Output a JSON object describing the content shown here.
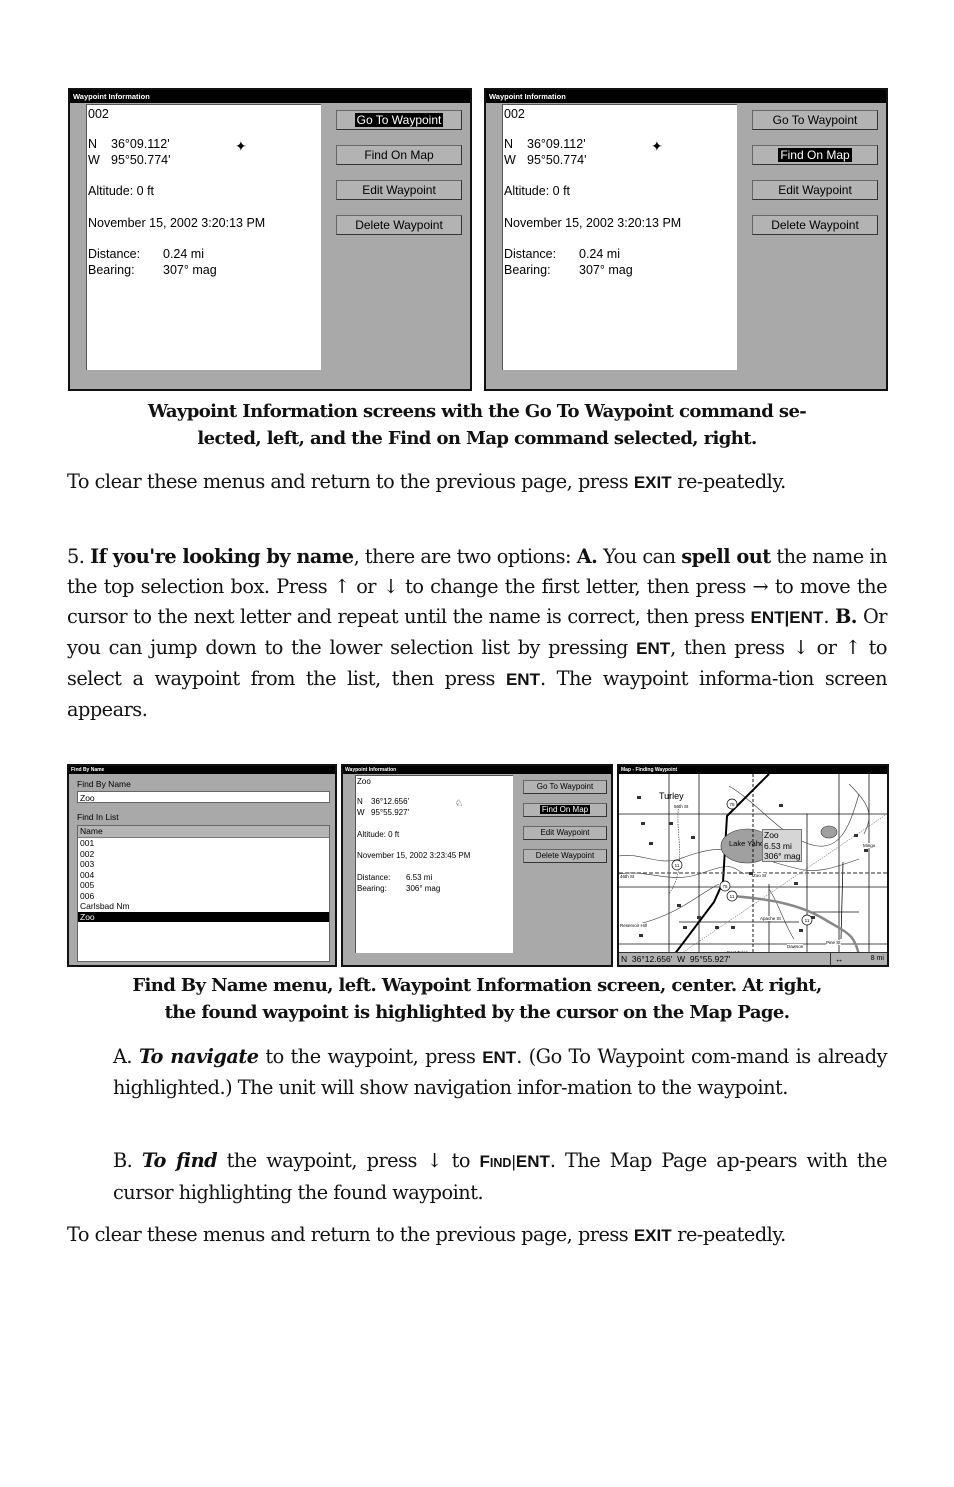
{
  "figure1": {
    "left_screen": {
      "title": "Waypoint Information",
      "name": "002",
      "lat_prefix": "N",
      "lat": "36°09.112'",
      "lon_prefix": "W",
      "lon": "95°50.774'",
      "altitude": "Altitude: 0 ft",
      "datetime": "November 15, 2002 3:20:13 PM",
      "distance_label": "Distance:",
      "distance_value": "0.24 mi",
      "bearing_label": "Bearing:",
      "bearing_value": "307° mag",
      "buttons": [
        "Go To Waypoint",
        "Find On Map",
        "Edit Waypoint",
        "Delete Waypoint"
      ],
      "selected_button": "Go To Waypoint"
    },
    "right_screen": {
      "title": "Waypoint Information",
      "name": "002",
      "lat_prefix": "N",
      "lat": "36°09.112'",
      "lon_prefix": "W",
      "lon": "95°50.774'",
      "altitude": "Altitude: 0 ft",
      "datetime": "November 15, 2002 3:20:13 PM",
      "distance_label": "Distance:",
      "distance_value": "0.24 mi",
      "bearing_label": "Bearing:",
      "bearing_value": "307° mag",
      "buttons": [
        "Go To Waypoint",
        "Find On Map",
        "Edit Waypoint",
        "Delete Waypoint"
      ],
      "selected_button": "Find On Map"
    },
    "caption_line1": "Waypoint Information screens with the Go To Waypoint command se-",
    "caption_line2": "lected, left, and the Find on Map command selected, right."
  },
  "para1": {
    "text_before": "To clear these menus and return to the previous page, press ",
    "key": "EXIT",
    "text_after": " re-peatedly."
  },
  "para2": {
    "number": "5. ",
    "bold1": "If you're looking by name",
    "t1": ", there are two options: ",
    "bold2": "A.",
    "t2": " You can ",
    "bold3": "spell out",
    "t3": " the name in the top selection box. Press ↑ or ↓ to change the first letter, then press → to move the cursor to the next letter and repeat until the name is correct, then press ",
    "key1": "ENT|ENT",
    "t4": ". ",
    "bold4": "B.",
    "t5": " Or you can jump down to the lower selection list by pressing ",
    "key2": "ENT",
    "t6": ", then press ↓ or ↑ to select a waypoint from the list, then press ",
    "key3": "ENT",
    "t7": ". The waypoint informa-tion screen appears."
  },
  "figure2": {
    "find_by_name": {
      "title": "Find By Name",
      "name_label": "Find By Name",
      "name_value": "Zoo",
      "list_label": "Find In List",
      "list_header": "Name",
      "items": [
        "001",
        "002",
        "003",
        "004",
        "005",
        "006",
        "Carlsbad Nm",
        "Zoo"
      ],
      "selected_item": "Zoo"
    },
    "waypoint_info": {
      "title": "Waypoint Information",
      "name": "Zoo",
      "lat_prefix": "N",
      "lat": "36°12.656'",
      "lon_prefix": "W",
      "lon": "95°55.927'",
      "altitude": "Altitude: 0 ft",
      "datetime": "November 15, 2002 3:23:45 PM",
      "distance_label": "Distance:",
      "distance_value": "6.53 mi",
      "bearing_label": "Bearing:",
      "bearing_value": "306° mag",
      "buttons": [
        "Go To Waypoint",
        "Find On Map",
        "Edit Waypoint",
        "Delete Waypoint"
      ],
      "selected_button": "Find On Map"
    },
    "map": {
      "title": "Map - Finding Waypoint",
      "popup_name": "Zoo",
      "popup_distance": "6.53 mi",
      "popup_bearing": "306° mag",
      "labels": {
        "turley": "Turley",
        "st56": "56th St",
        "lake": "Lake Yaho",
        "mingo": "Mingo",
        "street46": "46th St",
        "zoo_st": "Zoo St",
        "apache": "Apache St",
        "dawson": "Dawson",
        "pine": "Pine St",
        "hill": "Reservoir Hill",
        "east_tulsa": "East Tulsa",
        "highway_75": "75",
        "highway_11": "11"
      },
      "status_lat_prefix": "N",
      "status_lat": "36°12.656'",
      "status_lon_prefix": "W",
      "status_lon": "95°55.927'",
      "zoom_icon": "↔",
      "zoom_value": "8 mi"
    },
    "caption_line1": "Find By Name menu, left. Waypoint Information screen, center. At right,",
    "caption_line2": "the found waypoint is highlighted by the cursor on the Map Page."
  },
  "stepA": {
    "prefix": "A. ",
    "bold_italic": "To navigate",
    "t1": " to the waypoint, press ",
    "key": "ENT",
    "t2": ". (Go To Waypoint com-mand is already highlighted.) The unit will show navigation infor-mation to the waypoint."
  },
  "stepB": {
    "prefix": "B. ",
    "bold_italic": "To find",
    "t1": " the waypoint, press ↓ to ",
    "key_find": "FIND",
    "key_sep": "|",
    "key_ent": "ENT",
    "t2": ". The Map Page ap-pears with the cursor highlighting the found waypoint."
  },
  "para3": {
    "text_before": "To clear these menus and return to the previous page, press ",
    "key": "EXIT",
    "text_after": " re-peatedly."
  }
}
